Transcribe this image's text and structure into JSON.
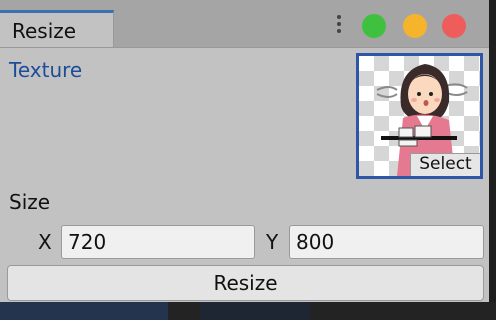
{
  "window": {
    "tab_title": "Resize",
    "controls": {
      "more_icon": "vertical-ellipsis",
      "green": "#3fc03f",
      "yellow": "#f6b42c",
      "red": "#ee5c5c"
    }
  },
  "texture": {
    "label": "Texture",
    "select_label": "Select"
  },
  "size": {
    "label": "Size",
    "x_label": "X",
    "x_value": "720",
    "y_label": "Y",
    "y_value": "800"
  },
  "actions": {
    "resize_label": "Resize"
  },
  "colors": {
    "accent": "#2f55a7",
    "label_blue": "#1d4c9a"
  }
}
